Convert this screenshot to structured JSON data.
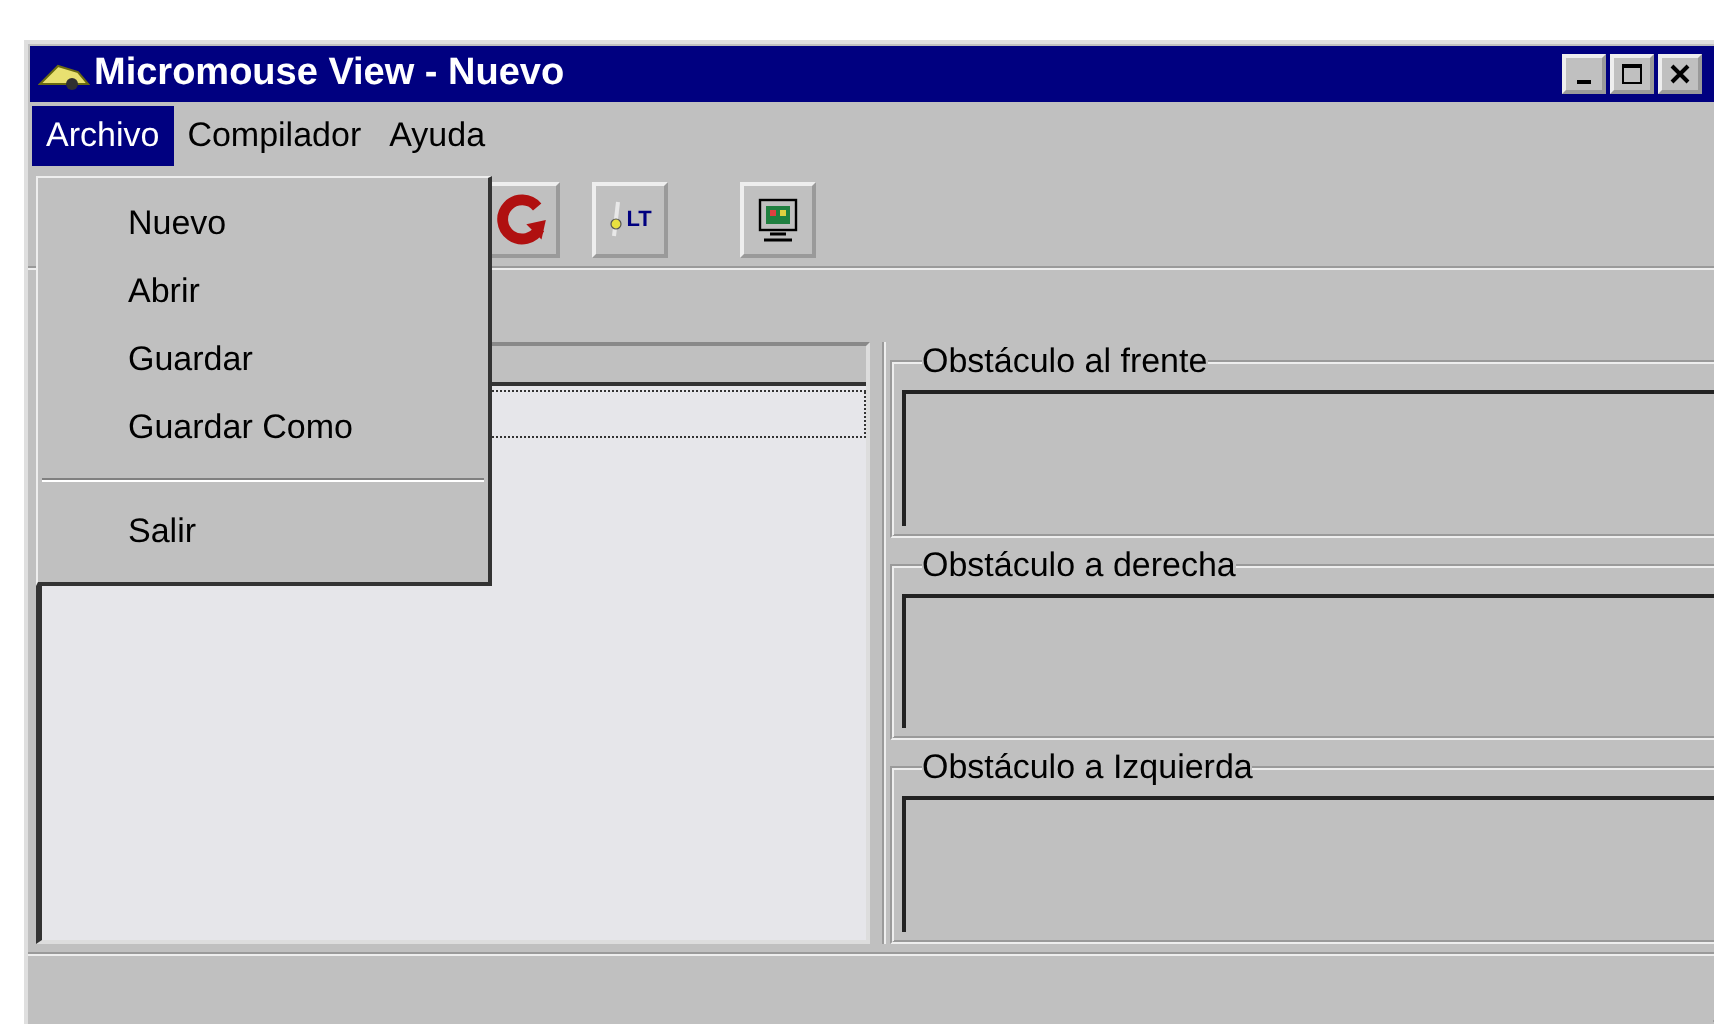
{
  "window": {
    "title": "Micromouse View - Nuevo"
  },
  "menu_bar": [
    {
      "label": "Archivo",
      "selected": true
    },
    {
      "label": "Compilador",
      "selected": false
    },
    {
      "label": "Ayuda",
      "selected": false
    }
  ],
  "open_menu": {
    "items": [
      {
        "kind": "item",
        "label": "Nuevo"
      },
      {
        "kind": "item",
        "label": "Abrir"
      },
      {
        "kind": "item",
        "label": "Guardar"
      },
      {
        "kind": "item",
        "label": "Guardar Como"
      },
      {
        "kind": "separator"
      },
      {
        "kind": "item",
        "label": "Salir"
      }
    ]
  },
  "toolbar": [
    {
      "kind": "refresh"
    },
    {
      "kind": "lt",
      "label": "LT"
    },
    {
      "kind": "monitor"
    }
  ],
  "sensor_panels": [
    {
      "title": "Obstáculo al frente"
    },
    {
      "title": "Obstáculo a derecha"
    },
    {
      "title": "Obstáculo a Izquierda"
    }
  ]
}
